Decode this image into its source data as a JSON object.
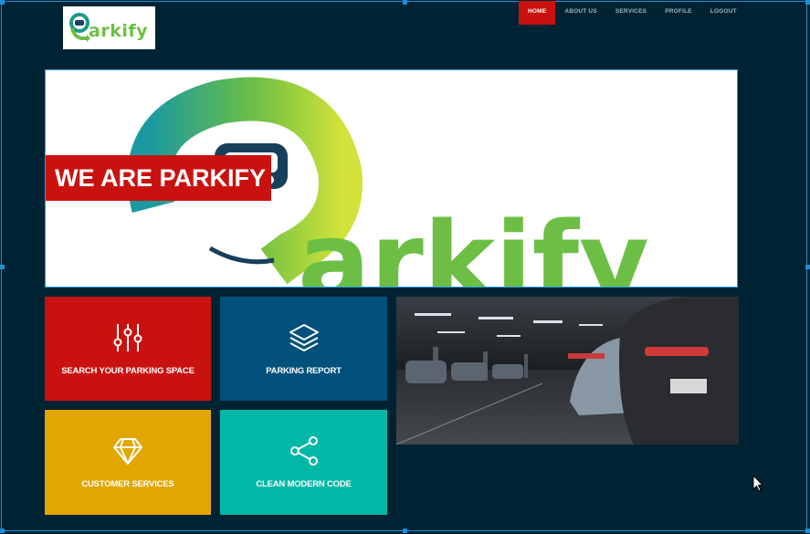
{
  "brand": {
    "logo_text": "arkify",
    "logo_mark_letter": "P",
    "colors": {
      "accent_red": "#c9120f",
      "navy": "#002333",
      "green": "#6cbf44"
    }
  },
  "nav": {
    "items": [
      {
        "label": "HOME",
        "active": true
      },
      {
        "label": "ABOUT US",
        "active": false
      },
      {
        "label": "SERVICES",
        "active": false
      },
      {
        "label": "PROFILE",
        "active": false
      },
      {
        "label": "LOGOUT",
        "active": false
      }
    ]
  },
  "hero": {
    "banner_text": "WE ARE PARKIFY",
    "art_text": "arkify"
  },
  "tiles": [
    {
      "label": "SEARCH YOUR PARKING SPACE",
      "icon": "sliders-icon",
      "color": "#c9120f"
    },
    {
      "label": "PARKING REPORT",
      "icon": "layers-icon",
      "color": "#01507b"
    },
    {
      "label": "CUSTOMER SERVICES",
      "icon": "diamond-icon",
      "color": "#e2a600"
    },
    {
      "label": "CLEAN MODERN CODE",
      "icon": "share-icon",
      "color": "#00b8a5"
    }
  ],
  "photo": {
    "subject": "parking-garage-photo"
  }
}
